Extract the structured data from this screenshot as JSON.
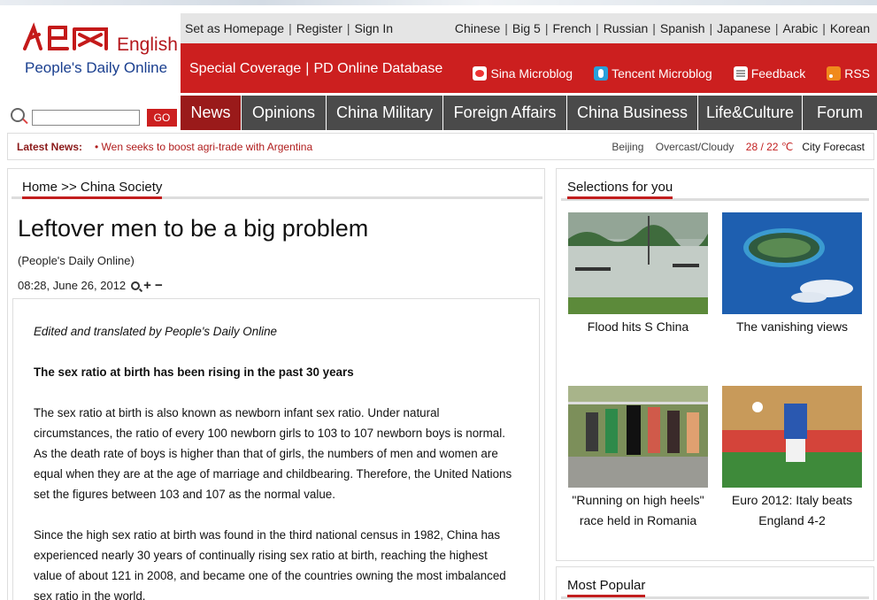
{
  "logo": {
    "cn_mark": "人民网",
    "english": "English",
    "tagline": "People's Daily Online"
  },
  "header": {
    "top_links": [
      "Set as Homepage",
      "Register",
      "Sign In"
    ],
    "languages": [
      "Chinese",
      "Big 5",
      "French",
      "Russian",
      "Spanish",
      "Japanese",
      "Arabic",
      "Korean"
    ],
    "special_coverage": "Special Coverage",
    "pd_database": "PD Online Database",
    "tools": [
      {
        "label": "Sina Microblog",
        "icon": "sina-weibo-icon"
      },
      {
        "label": "Tencent Microblog",
        "icon": "tencent-weibo-icon"
      },
      {
        "label": "Feedback",
        "icon": "feedback-icon"
      },
      {
        "label": "RSS",
        "icon": "rss-icon"
      }
    ]
  },
  "search": {
    "placeholder": "",
    "go_label": "GO"
  },
  "nav": {
    "items": [
      "News",
      "Opinions",
      "China Military",
      "Foreign Affairs",
      "China Business",
      "Life&Culture",
      "Forum"
    ],
    "active": "News"
  },
  "latest": {
    "label": "Latest News:",
    "headline": "• Wen seeks to boost agri-trade with Argentina",
    "city": "Beijing",
    "condition": "Overcast/Cloudy",
    "temperature": "28 / 22 ℃",
    "forecast_link": "City Forecast"
  },
  "article": {
    "breadcrumb": "Home >> China Society",
    "title": "Leftover men to be a big problem",
    "source": "(People's Daily Online)",
    "datetime": "08:28, June 26, 2012",
    "paragraphs": [
      {
        "style": "ital",
        "text": "Edited and translated by People's Daily Online"
      },
      {
        "style": "bold",
        "text": "The sex ratio at birth has been rising in the past 30 years"
      },
      {
        "style": "normal",
        "text": "The sex ratio at birth is also known as newborn infant sex ratio. Under natural circumstances, the ratio of every 100 newborn girls to 103 to 107 newborn boys is normal. As the death rate of boys is higher than that of girls, the numbers of men and women are equal when they are at the age of marriage and childbearing. Therefore, the United Nations set the figures between 103 and 107 as the normal value."
      },
      {
        "style": "normal",
        "text": "Since the high sex ratio at birth was found in the third national census in 1982, China has experienced nearly 30 years of continually rising sex ratio at birth, reaching the highest value of about 121 in 2008, and became one of the countries owning the most imbalanced sex ratio in the world."
      }
    ]
  },
  "sidebar": {
    "selections_title": "Selections for you",
    "cards": [
      {
        "caption": "Flood hits S China"
      },
      {
        "caption": "The vanishing views"
      },
      {
        "caption": "\"Running on high heels\" race held in Romania"
      },
      {
        "caption": "Euro 2012: Italy beats England 4-2"
      }
    ],
    "most_popular_title": "Most Popular"
  },
  "colors": {
    "brand_red": "#cc1f1f",
    "nav_grey": "#4a4a4a",
    "nav_active": "#9a1a1a"
  }
}
